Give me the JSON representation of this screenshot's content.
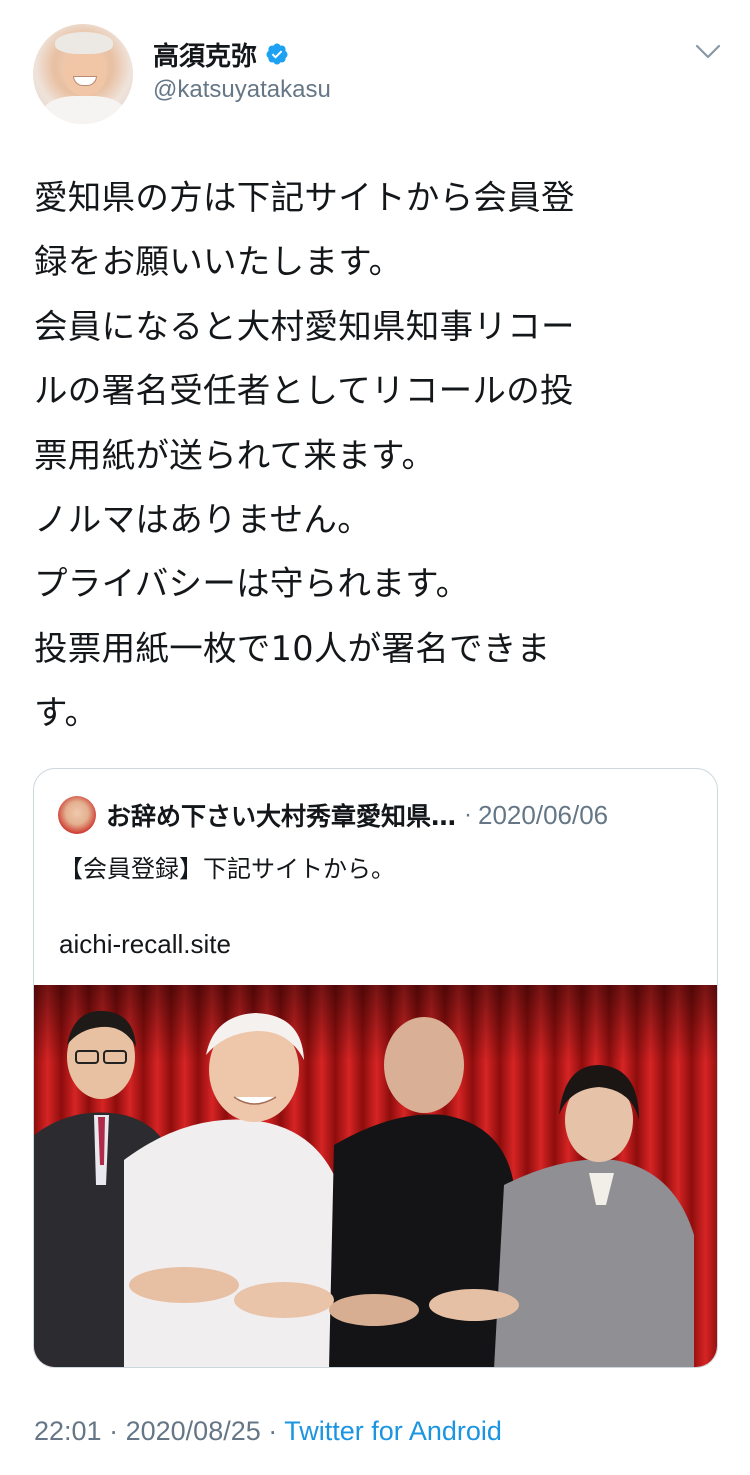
{
  "author": {
    "display_name": "高須克弥",
    "handle": "@katsuyatakasu",
    "verified_icon": "verified-badge-icon",
    "verified_color": "#1da1f2"
  },
  "tweet": {
    "lines": [
      "愛知県の方は下記サイトから会員登",
      "録をお願いいたします。",
      "会員になると大村愛知県知事リコー",
      "ルの署名受任者としてリコールの投",
      "票用紙が送られて来ます。",
      "ノルマはありません。",
      "プライバシーは守られます。",
      "投票用紙一枚で10人が署名できま",
      "す。"
    ]
  },
  "quoted_tweet": {
    "author_name": "お辞め下さい大村秀章愛知県…",
    "separator": "·",
    "date": "2020/06/06",
    "text": "【会員登録】下記サイトから。",
    "link": "aichi-recall.site"
  },
  "footer": {
    "time": "22:01",
    "separator1": "·",
    "date": "2020/08/25",
    "separator2": "·",
    "source": "Twitter for Android",
    "source_color": "#1b95e0"
  },
  "colors": {
    "text": "#14171a",
    "secondary": "#657786",
    "border": "#ccd6dd",
    "curtain": "#c81e1e"
  }
}
